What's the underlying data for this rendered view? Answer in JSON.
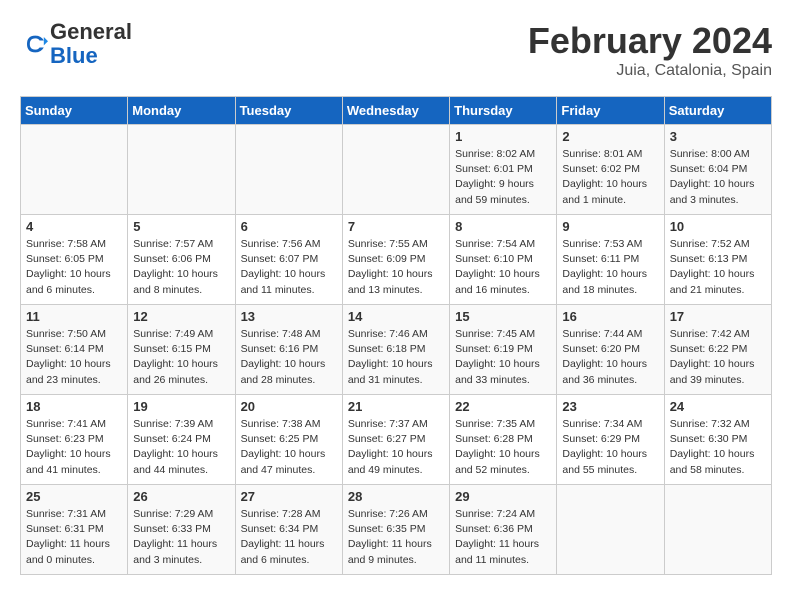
{
  "header": {
    "logo_general": "General",
    "logo_blue": "Blue",
    "month_title": "February 2024",
    "location": "Juia, Catalonia, Spain"
  },
  "days_of_week": [
    "Sunday",
    "Monday",
    "Tuesday",
    "Wednesday",
    "Thursday",
    "Friday",
    "Saturday"
  ],
  "weeks": [
    [
      {
        "day": "",
        "info": ""
      },
      {
        "day": "",
        "info": ""
      },
      {
        "day": "",
        "info": ""
      },
      {
        "day": "",
        "info": ""
      },
      {
        "day": "1",
        "info": "Sunrise: 8:02 AM\nSunset: 6:01 PM\nDaylight: 9 hours and 59 minutes."
      },
      {
        "day": "2",
        "info": "Sunrise: 8:01 AM\nSunset: 6:02 PM\nDaylight: 10 hours and 1 minute."
      },
      {
        "day": "3",
        "info": "Sunrise: 8:00 AM\nSunset: 6:04 PM\nDaylight: 10 hours and 3 minutes."
      }
    ],
    [
      {
        "day": "4",
        "info": "Sunrise: 7:58 AM\nSunset: 6:05 PM\nDaylight: 10 hours and 6 minutes."
      },
      {
        "day": "5",
        "info": "Sunrise: 7:57 AM\nSunset: 6:06 PM\nDaylight: 10 hours and 8 minutes."
      },
      {
        "day": "6",
        "info": "Sunrise: 7:56 AM\nSunset: 6:07 PM\nDaylight: 10 hours and 11 minutes."
      },
      {
        "day": "7",
        "info": "Sunrise: 7:55 AM\nSunset: 6:09 PM\nDaylight: 10 hours and 13 minutes."
      },
      {
        "day": "8",
        "info": "Sunrise: 7:54 AM\nSunset: 6:10 PM\nDaylight: 10 hours and 16 minutes."
      },
      {
        "day": "9",
        "info": "Sunrise: 7:53 AM\nSunset: 6:11 PM\nDaylight: 10 hours and 18 minutes."
      },
      {
        "day": "10",
        "info": "Sunrise: 7:52 AM\nSunset: 6:13 PM\nDaylight: 10 hours and 21 minutes."
      }
    ],
    [
      {
        "day": "11",
        "info": "Sunrise: 7:50 AM\nSunset: 6:14 PM\nDaylight: 10 hours and 23 minutes."
      },
      {
        "day": "12",
        "info": "Sunrise: 7:49 AM\nSunset: 6:15 PM\nDaylight: 10 hours and 26 minutes."
      },
      {
        "day": "13",
        "info": "Sunrise: 7:48 AM\nSunset: 6:16 PM\nDaylight: 10 hours and 28 minutes."
      },
      {
        "day": "14",
        "info": "Sunrise: 7:46 AM\nSunset: 6:18 PM\nDaylight: 10 hours and 31 minutes."
      },
      {
        "day": "15",
        "info": "Sunrise: 7:45 AM\nSunset: 6:19 PM\nDaylight: 10 hours and 33 minutes."
      },
      {
        "day": "16",
        "info": "Sunrise: 7:44 AM\nSunset: 6:20 PM\nDaylight: 10 hours and 36 minutes."
      },
      {
        "day": "17",
        "info": "Sunrise: 7:42 AM\nSunset: 6:22 PM\nDaylight: 10 hours and 39 minutes."
      }
    ],
    [
      {
        "day": "18",
        "info": "Sunrise: 7:41 AM\nSunset: 6:23 PM\nDaylight: 10 hours and 41 minutes."
      },
      {
        "day": "19",
        "info": "Sunrise: 7:39 AM\nSunset: 6:24 PM\nDaylight: 10 hours and 44 minutes."
      },
      {
        "day": "20",
        "info": "Sunrise: 7:38 AM\nSunset: 6:25 PM\nDaylight: 10 hours and 47 minutes."
      },
      {
        "day": "21",
        "info": "Sunrise: 7:37 AM\nSunset: 6:27 PM\nDaylight: 10 hours and 49 minutes."
      },
      {
        "day": "22",
        "info": "Sunrise: 7:35 AM\nSunset: 6:28 PM\nDaylight: 10 hours and 52 minutes."
      },
      {
        "day": "23",
        "info": "Sunrise: 7:34 AM\nSunset: 6:29 PM\nDaylight: 10 hours and 55 minutes."
      },
      {
        "day": "24",
        "info": "Sunrise: 7:32 AM\nSunset: 6:30 PM\nDaylight: 10 hours and 58 minutes."
      }
    ],
    [
      {
        "day": "25",
        "info": "Sunrise: 7:31 AM\nSunset: 6:31 PM\nDaylight: 11 hours and 0 minutes."
      },
      {
        "day": "26",
        "info": "Sunrise: 7:29 AM\nSunset: 6:33 PM\nDaylight: 11 hours and 3 minutes."
      },
      {
        "day": "27",
        "info": "Sunrise: 7:28 AM\nSunset: 6:34 PM\nDaylight: 11 hours and 6 minutes."
      },
      {
        "day": "28",
        "info": "Sunrise: 7:26 AM\nSunset: 6:35 PM\nDaylight: 11 hours and 9 minutes."
      },
      {
        "day": "29",
        "info": "Sunrise: 7:24 AM\nSunset: 6:36 PM\nDaylight: 11 hours and 11 minutes."
      },
      {
        "day": "",
        "info": ""
      },
      {
        "day": "",
        "info": ""
      }
    ]
  ]
}
